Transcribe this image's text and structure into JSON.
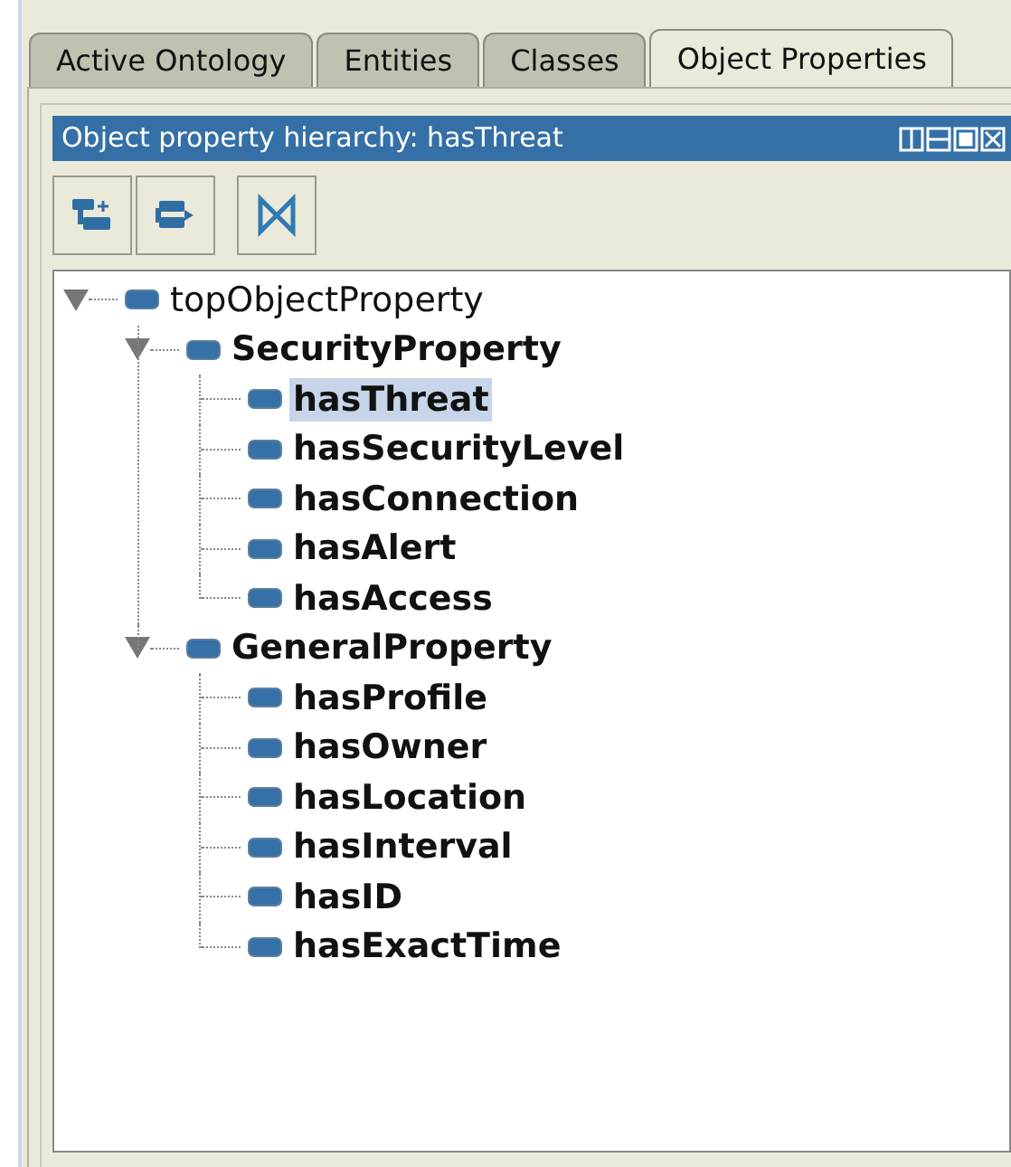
{
  "tabs": [
    {
      "label": "Active Ontology",
      "selected": false
    },
    {
      "label": "Entities",
      "selected": false
    },
    {
      "label": "Classes",
      "selected": false
    },
    {
      "label": "Object Properties",
      "selected": true
    }
  ],
  "panel": {
    "title": "Object property hierarchy: hasThreat"
  },
  "toolbar": [
    {
      "kind": "add-sub"
    },
    {
      "kind": "add-sibling"
    },
    {
      "kind": "delete"
    }
  ],
  "tree": [
    {
      "label": "topObjectProperty",
      "bold": false,
      "selected": false,
      "expanded": true,
      "children": [
        {
          "label": "SecurityProperty",
          "bold": true,
          "selected": false,
          "expanded": true,
          "children": [
            {
              "label": "hasThreat",
              "bold": true,
              "selected": true
            },
            {
              "label": "hasSecurityLevel",
              "bold": true,
              "selected": false
            },
            {
              "label": "hasConnection",
              "bold": true,
              "selected": false
            },
            {
              "label": "hasAlert",
              "bold": true,
              "selected": false
            },
            {
              "label": "hasAccess",
              "bold": true,
              "selected": false
            }
          ]
        },
        {
          "label": "GeneralProperty",
          "bold": true,
          "selected": false,
          "expanded": true,
          "children": [
            {
              "label": "hasProfile",
              "bold": true,
              "selected": false
            },
            {
              "label": "hasOwner",
              "bold": true,
              "selected": false
            },
            {
              "label": "hasLocation",
              "bold": true,
              "selected": false
            },
            {
              "label": "hasInterval",
              "bold": true,
              "selected": false
            },
            {
              "label": "hasID",
              "bold": true,
              "selected": false
            },
            {
              "label": "hasExactTime",
              "bold": true,
              "selected": false
            }
          ]
        }
      ]
    }
  ]
}
